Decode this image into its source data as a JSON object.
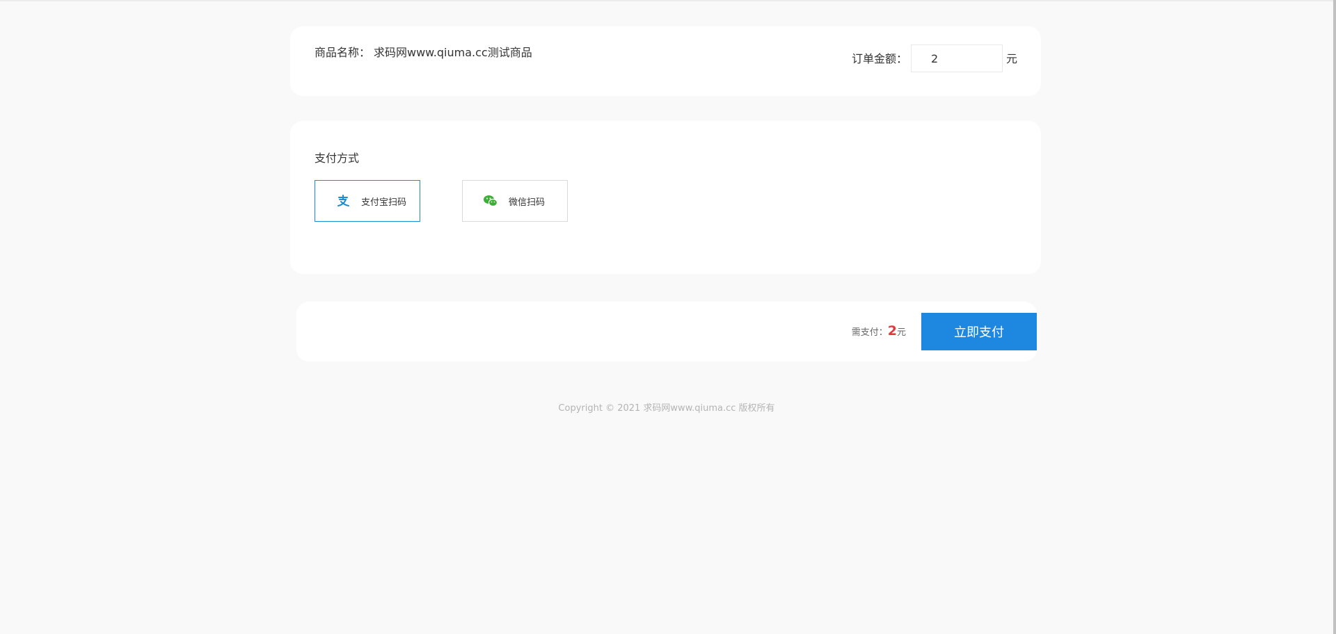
{
  "product": {
    "label": "商品名称：",
    "name": "求码网www.qiuma.cc测试商品"
  },
  "order": {
    "amount_label": "订单金额：",
    "amount_value": "2",
    "unit": "元"
  },
  "payment": {
    "title": "支付方式",
    "options": [
      {
        "label": "支付宝扫码",
        "icon": "alipay-icon",
        "selected": true
      },
      {
        "label": "微信扫码",
        "icon": "wechat-icon",
        "selected": false
      }
    ]
  },
  "summary": {
    "need_pay_label": "需支付：",
    "amount": "2",
    "unit": "元",
    "pay_button": "立即支付"
  },
  "footer": {
    "copyright": "Copyright © 2021 求码网www.qiuma.cc 版权所有"
  },
  "colors": {
    "accent": "#1e88e0",
    "alipay": "#1a8dd6",
    "wechat": "#3cb034",
    "price": "#e4393c"
  }
}
